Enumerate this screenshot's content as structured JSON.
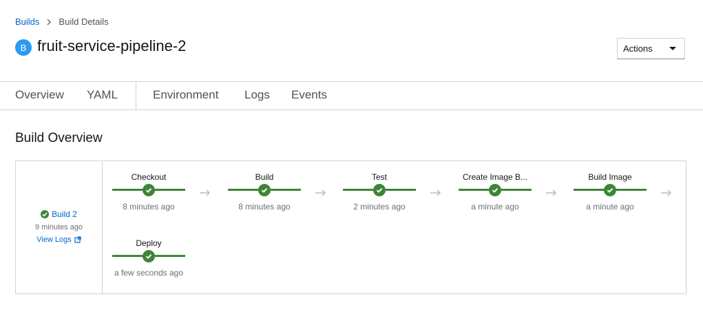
{
  "breadcrumb": {
    "parent": "Builds",
    "current": "Build Details"
  },
  "header": {
    "badge": "B",
    "title": "fruit-service-pipeline-2",
    "actions_label": "Actions"
  },
  "tabs": [
    "Overview",
    "YAML",
    "Environment",
    "Logs",
    "Events"
  ],
  "section_title": "Build Overview",
  "build": {
    "name": "Build 2",
    "time": "9 minutes ago",
    "view_logs": "View Logs"
  },
  "tasks": [
    {
      "name": "Checkout",
      "time": "8 minutes ago",
      "status": "succeeded"
    },
    {
      "name": "Build",
      "time": "8 minutes ago",
      "status": "succeeded"
    },
    {
      "name": "Test",
      "time": "2 minutes ago",
      "status": "succeeded"
    },
    {
      "name": "Create Image B...",
      "time": "a minute ago",
      "status": "succeeded"
    },
    {
      "name": "Build Image",
      "time": "a minute ago",
      "status": "succeeded"
    },
    {
      "name": "Deploy",
      "time": "a few seconds ago",
      "status": "succeeded"
    }
  ],
  "colors": {
    "success": "#3e8635",
    "link": "#0066cc",
    "badge": "#2b9af3"
  }
}
